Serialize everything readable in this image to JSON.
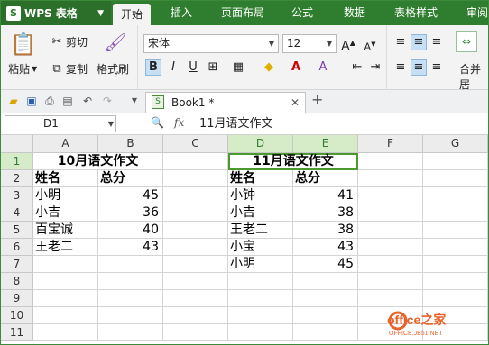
{
  "app": {
    "title": "WPS 表格",
    "logo": "S"
  },
  "menu_tabs": [
    {
      "label": "开始",
      "active": true
    },
    {
      "label": "插入",
      "active": false
    },
    {
      "label": "页面布局",
      "active": false
    },
    {
      "label": "公式",
      "active": false
    },
    {
      "label": "数据",
      "active": false
    },
    {
      "label": "表格样式",
      "active": false
    },
    {
      "label": "审阅",
      "active": false
    }
  ],
  "ribbon": {
    "paste": "粘贴",
    "cut": "剪切",
    "copy": "复制",
    "format_painter": "格式刷",
    "font_name": "宋体",
    "font_size": "12",
    "bold": "B",
    "italic": "I",
    "underline": "U",
    "merge": "合并居"
  },
  "doc_tab": {
    "name": "Book1 *"
  },
  "formula_bar": {
    "cell_ref": "D1",
    "fx": "fx",
    "value": "11月语文作文"
  },
  "columns": [
    "A",
    "B",
    "C",
    "D",
    "E",
    "F",
    "G"
  ],
  "rows": [
    "1",
    "2",
    "3",
    "4",
    "5",
    "6",
    "7",
    "8",
    "9",
    "10",
    "11"
  ],
  "cells": {
    "A1": "10月语文作文",
    "A2": "姓名",
    "B2": "总分",
    "A3": "小明",
    "B3": "45",
    "A4": "小吉",
    "B4": "36",
    "A5": "百宝诚",
    "B5": "40",
    "A6": "王老二",
    "B6": "43",
    "D1": "11月语文作文",
    "D2": "姓名",
    "E2": "总分",
    "D3": "小钟",
    "E3": "41",
    "D4": "小吉",
    "E4": "38",
    "D5": "王老二",
    "E5": "38",
    "D6": "小宝",
    "E6": "43",
    "D7": "小明",
    "E7": "45"
  },
  "watermark": {
    "brand": "office之家",
    "url": "OFFICE.JB51.NET"
  },
  "colors": {
    "accent": "#2f7d2f",
    "selection": "#4a9a2f"
  }
}
